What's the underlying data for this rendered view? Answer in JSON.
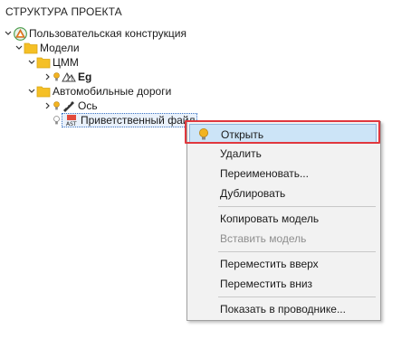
{
  "panel": {
    "title": "СТРУКТУРА ПРОЕКТА"
  },
  "tree": {
    "root": "Пользовательская конструкция",
    "models": "Модели",
    "tsmm": "ЦММ",
    "eg": "Eg",
    "roads": "Автомобильные дороги",
    "axis": "Ось",
    "welcome": "Приветственный файл"
  },
  "menu": {
    "items": [
      {
        "label": "Открыть",
        "enabled": true,
        "highlighted": true,
        "icon": "lightbulb-icon"
      },
      {
        "label": "Удалить",
        "enabled": true
      },
      {
        "label": "Переименовать...",
        "enabled": true
      },
      {
        "label": "Дублировать",
        "enabled": true
      },
      {
        "label": "Копировать модель",
        "enabled": true
      },
      {
        "label": "Вставить модель",
        "enabled": false
      },
      {
        "label": "Переместить вверх",
        "enabled": true
      },
      {
        "label": "Переместить вниз",
        "enabled": true
      },
      {
        "label": "Показать в проводнике...",
        "enabled": true
      }
    ]
  },
  "colors": {
    "highlight": "#cce4f7",
    "annotation": "#e0383e",
    "folder": "#f5c026"
  }
}
